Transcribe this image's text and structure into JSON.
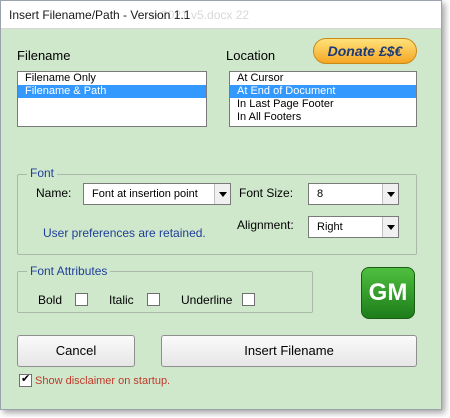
{
  "window": {
    "title": "Insert Filename/Path - Version 1.1",
    "background_title": "e 2021 v5.docx 22"
  },
  "filename": {
    "label": "Filename",
    "options": [
      "Filename Only",
      "Filename & Path"
    ],
    "selected_index": 1
  },
  "location": {
    "label": "Location",
    "options": [
      "At Cursor",
      "At End of Document",
      "In Last Page Footer",
      "In All Footers"
    ],
    "selected_index": 1
  },
  "donate": {
    "label": "Donate £$€"
  },
  "font": {
    "group_label": "Font",
    "name_label": "Name:",
    "name_value": "Font at insertion point",
    "size_label": "Font Size:",
    "size_value": "8",
    "alignment_label": "Alignment:",
    "alignment_value": "Right",
    "info_text": "User preferences are retained."
  },
  "font_attributes": {
    "group_label": "Font Attributes",
    "bold_label": "Bold",
    "italic_label": "Italic",
    "underline_label": "Underline",
    "bold": false,
    "italic": false,
    "underline": false
  },
  "logo": {
    "text": "GM"
  },
  "buttons": {
    "cancel": "Cancel",
    "insert": "Insert Filename"
  },
  "disclaimer": {
    "label": "Show disclaimer on startup.",
    "checked": true
  },
  "colors": {
    "dialog_bg": "#cfe8cc",
    "accent_blue": "#1f3f99",
    "selection": "#3399ff",
    "disclaimer_red": "#c0392b",
    "logo_green": "#2e9b2a"
  }
}
